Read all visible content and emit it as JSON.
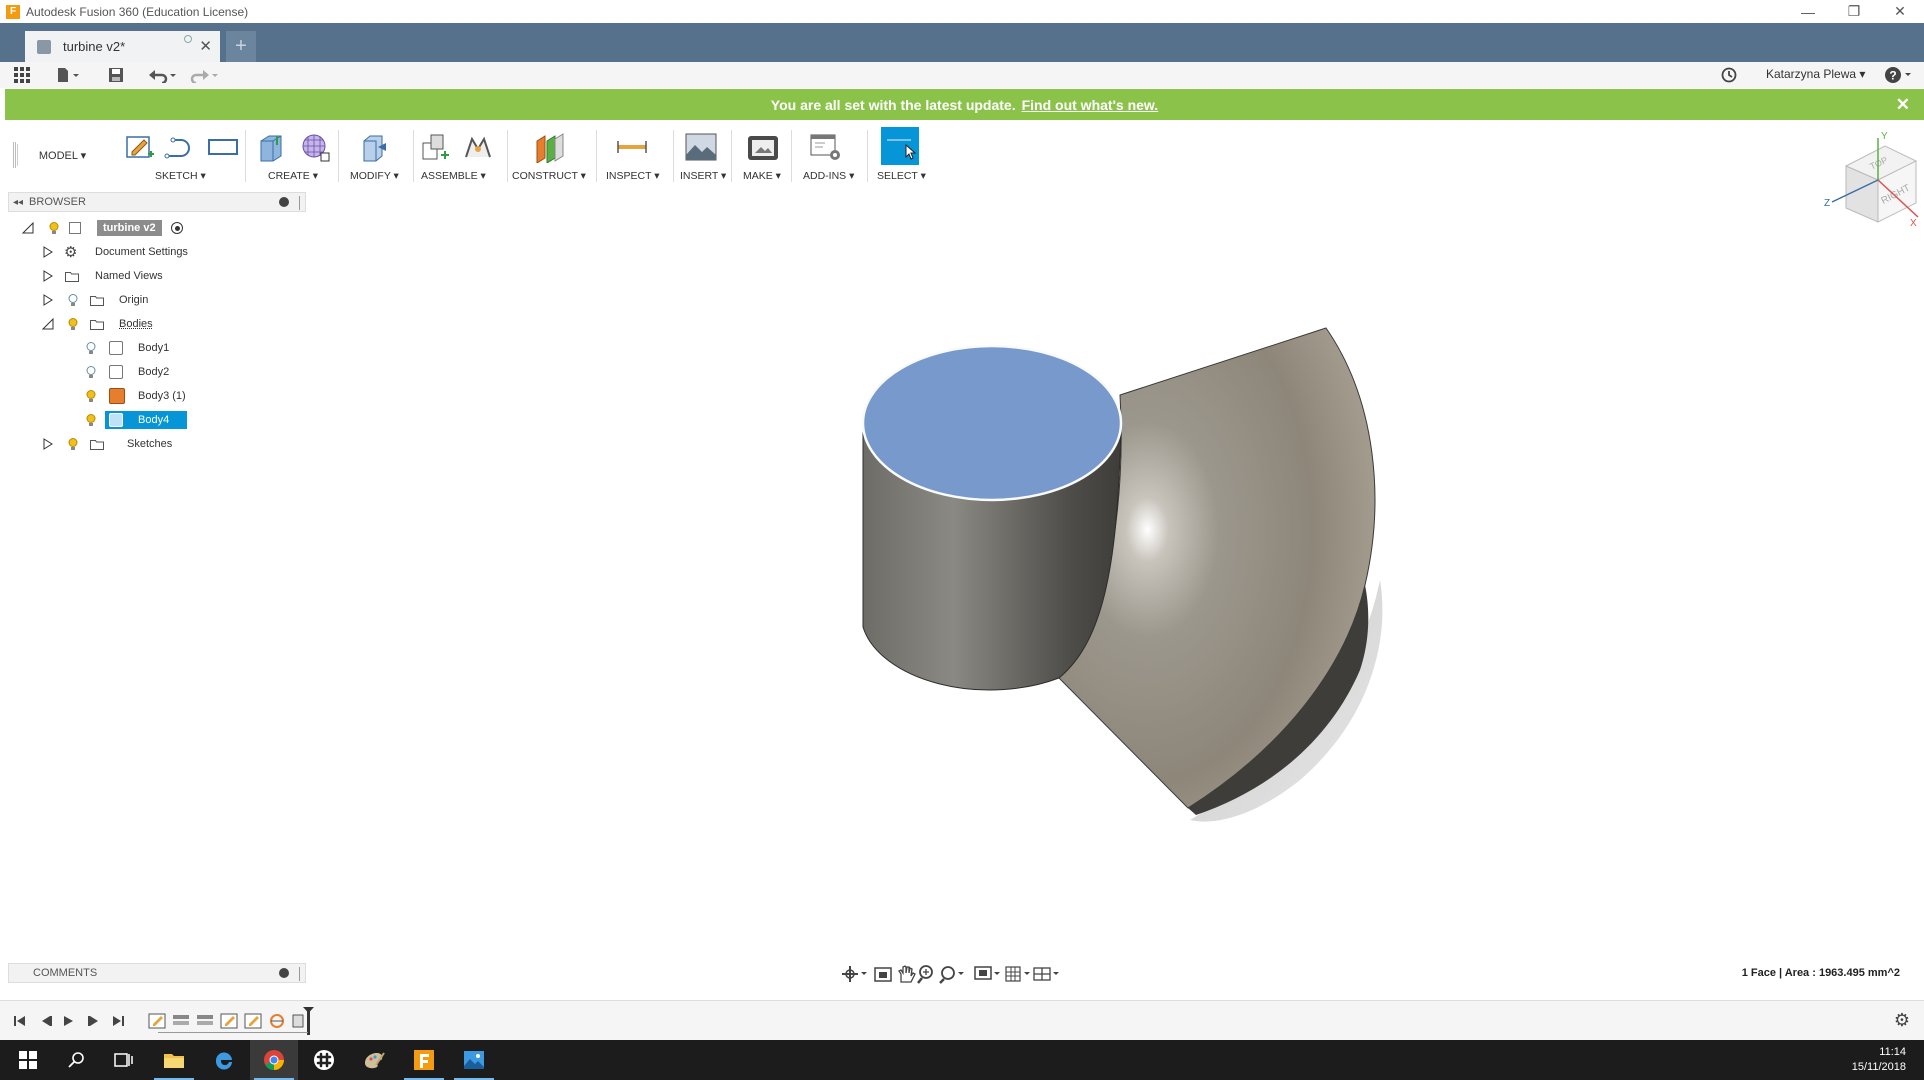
{
  "window": {
    "title": "Autodesk Fusion 360 (Education License)",
    "app_icon_letter": "F",
    "minimize_glyph": "—",
    "restore_glyph": "❐",
    "close_glyph": "✕"
  },
  "tabs": {
    "doc_tab_label": "turbine v2*",
    "new_tab_glyph": "+"
  },
  "quick_toolbar": {
    "user_name": "Katarzyna Plewa ▾",
    "help_glyph": "?"
  },
  "banner": {
    "message": "You are all set with the latest update.",
    "link_text": "Find out what's new.",
    "close_glyph": "✕"
  },
  "toolbar": {
    "workspace": "MODEL ▾",
    "groups": [
      {
        "label": "SKETCH ▾"
      },
      {
        "label": "CREATE ▾"
      },
      {
        "label": "MODIFY ▾"
      },
      {
        "label": "ASSEMBLE ▾"
      },
      {
        "label": "CONSTRUCT ▾"
      },
      {
        "label": "INSPECT ▾"
      },
      {
        "label": "INSERT ▾"
      },
      {
        "label": "MAKE ▾"
      },
      {
        "label": "ADD-INS ▾"
      },
      {
        "label": "SELECT ▾"
      }
    ]
  },
  "browser": {
    "header": "BROWSER",
    "items": [
      {
        "label": "turbine v2"
      },
      {
        "label": "Document Settings"
      },
      {
        "label": "Named Views"
      },
      {
        "label": "Origin"
      },
      {
        "label": "Bodies"
      },
      {
        "label": "Body1"
      },
      {
        "label": "Body2"
      },
      {
        "label": "Body3 (1)"
      },
      {
        "label": "Body4"
      },
      {
        "label": "Sketches"
      }
    ]
  },
  "viewcube": {
    "face_top": "TOP",
    "face_right": "RIGHT",
    "axis_z": "Z",
    "axis_x": "X",
    "axis_y": "Y"
  },
  "comments": {
    "header": "COMMENTS"
  },
  "status": {
    "selection_info": "1 Face | Area : 1963.495 mm^2"
  },
  "taskbar": {
    "time": "11:14",
    "date": "15/11/2018"
  },
  "colors": {
    "tabbar": "#55718c",
    "banner": "#8bc34a",
    "selection": "#0696d7",
    "selected_face": "#7799cc",
    "body_dark": "#5d5c57",
    "body_light": "#a59e91"
  },
  "icons": [
    "grid-apps-icon",
    "file-icon",
    "save-icon",
    "undo-icon",
    "redo-icon",
    "history-icon",
    "help-icon",
    "settings-icon",
    "bulb-icon",
    "folder-icon",
    "gear-icon"
  ]
}
